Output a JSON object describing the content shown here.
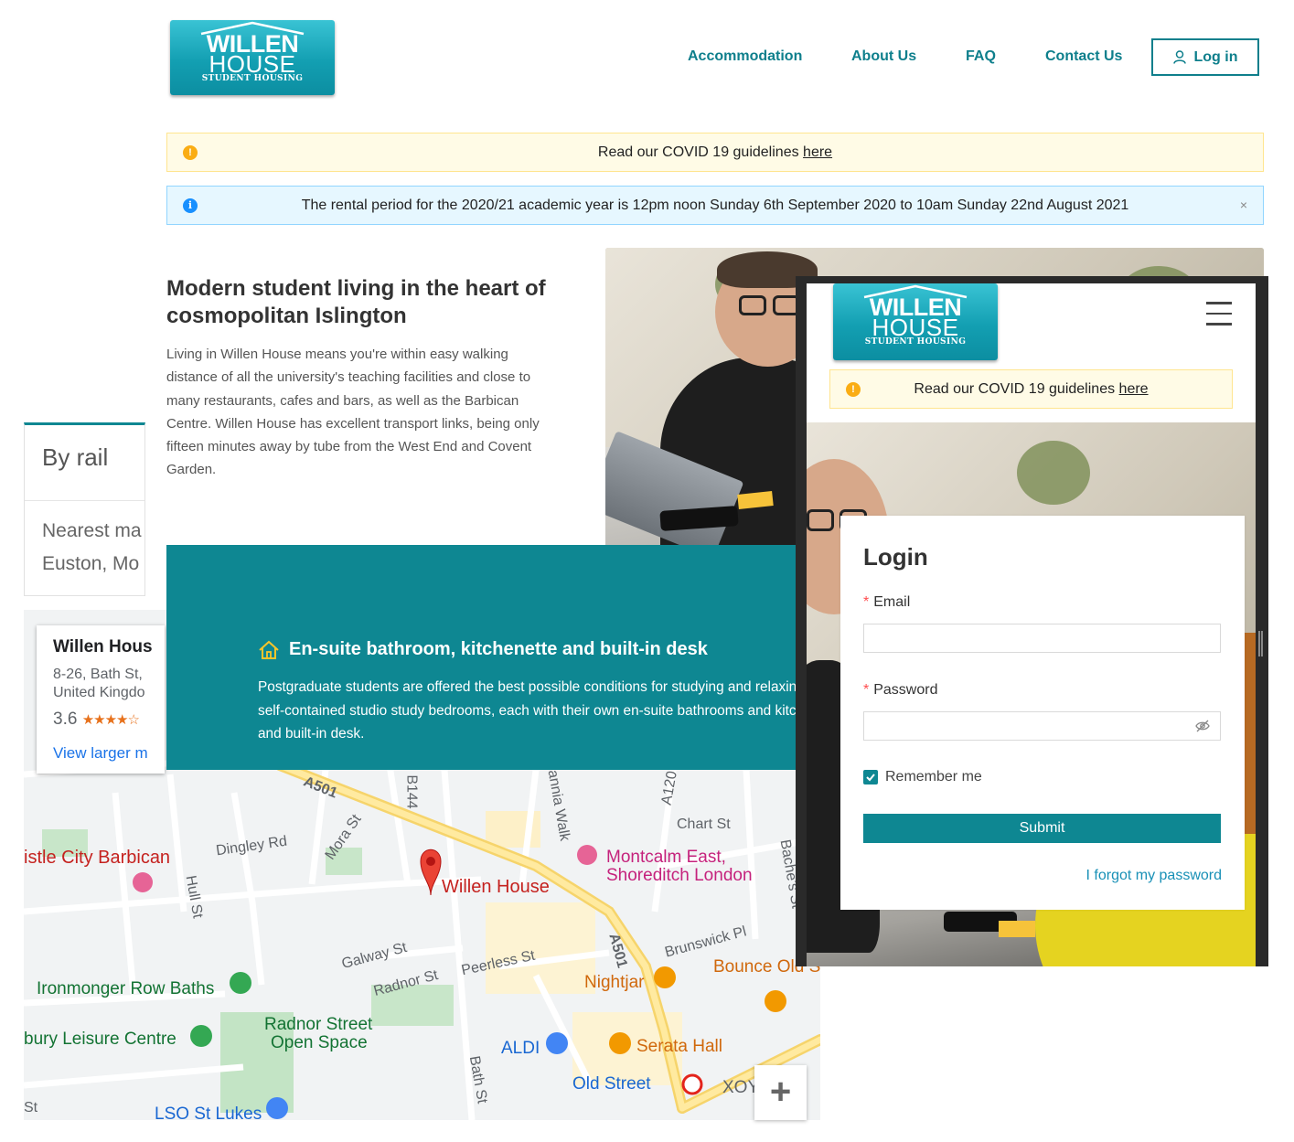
{
  "brand": {
    "logo_line1": "WILLEN",
    "logo_line2": "HOUSE",
    "logo_line3": "STUDENT HOUSING"
  },
  "nav": {
    "items": [
      "Accommodation",
      "About Us",
      "FAQ",
      "Contact Us"
    ],
    "login": "Log in",
    "accent_color": "#0e7f8c"
  },
  "alerts": {
    "covid_text": "Read our COVID 19 guidelines",
    "covid_link": "here",
    "rental_text": "The rental period for the 2020/21 academic year is 12pm noon Sunday 6th September 2020 to 10am Sunday 22nd August 2021",
    "close_glyph": "×"
  },
  "hero": {
    "title": "Modern student living in the heart of cosmopolitan Islington",
    "body": "Living in Willen House means you're within easy walking distance of all the university's teaching facilities and close to many restaurants, cafes and bars, as well as the Barbican Centre. Willen House has excellent transport links, being only fifteen minutes away by tube from the West End and Covent Garden."
  },
  "rail_card": {
    "heading": "By rail",
    "line1": "Nearest ma",
    "line2": "Euston, Mo"
  },
  "map": {
    "card_title": "Willen Hous",
    "card_address1": "8-26, Bath St,",
    "card_address2": "United Kingdo",
    "card_rating": "3.6",
    "card_stars": "★★★★☆",
    "card_link": "View larger m",
    "zoom_in": "+",
    "labels": {
      "barbican": "istle City Barbican",
      "dingley": "Dingley Rd",
      "mora": "Mora St",
      "b144": "B144",
      "a501_top": "A501",
      "hull": "Hull St",
      "willen": "Willen House",
      "montcalm1": "Montcalm East,",
      "montcalm2": "Shoreditch London",
      "chart": "Chart St",
      "bache": "Bache's St",
      "tannia": "annia Walk",
      "a120": "A120",
      "galway": "Galway St",
      "radnor_st": "Radnor St",
      "peerless": "Peerless St",
      "a501_mid": "A501",
      "brunswick": "Brunswick Pl",
      "bounce": "Bounce Old S",
      "nightjar": "Nightjar",
      "ironmonger": "Ironmonger Row Baths",
      "leisure": "bury Leisure Centre",
      "radnor_space1": "Radnor Street",
      "radnor_space2": "Open Space",
      "aldi": "ALDI",
      "serata": "Serata Hall",
      "old_street": "Old Street",
      "xoy": "XOY",
      "lso": "LSO St Lukes",
      "bath_st": "Bath St",
      "st": "St"
    }
  },
  "feature": {
    "title": "En-suite bathroom, kitchenette and built-in desk",
    "body": "Postgraduate students are offered the best possible conditions for studying and relaxing in self-contained studio study bedrooms, each with their own en-suite bathrooms and kitchenette and built-in desk."
  },
  "mobile": {
    "covid_text": "Read our COVID 19 guidelines",
    "covid_link": "here",
    "login": {
      "title": "Login",
      "email_label": "Email",
      "password_label": "Password",
      "remember": "Remember me",
      "submit": "Submit",
      "forgot": "I forgot my password"
    }
  }
}
